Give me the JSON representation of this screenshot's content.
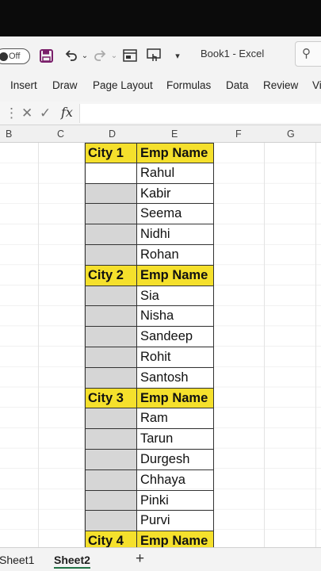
{
  "titlebar": {
    "autosave_label": "Off",
    "title": "Book1  -  Excel",
    "search_icon": "search-icon"
  },
  "ribbon": {
    "tabs": [
      "Insert",
      "Draw",
      "Page Layout",
      "Formulas",
      "Data",
      "Review",
      "Vi"
    ]
  },
  "formula_bar": {
    "fx_label": "fx",
    "value": ""
  },
  "columns": [
    "B",
    "C",
    "D",
    "E",
    "F",
    "G"
  ],
  "table": {
    "groups": [
      {
        "city_header": "City 1",
        "name_header": "Emp Name",
        "names": [
          "Rahul",
          "Kabir",
          "Seema",
          "Nidhi",
          "Rohan"
        ]
      },
      {
        "city_header": "City 2",
        "name_header": "Emp Name",
        "names": [
          "Sia",
          "Nisha",
          "Sandeep",
          "Rohit",
          "Santosh"
        ]
      },
      {
        "city_header": "City 3",
        "name_header": "Emp Name",
        "names": [
          "Ram",
          "Tarun",
          "Durgesh",
          "Chhaya",
          "Pinki",
          "Purvi"
        ]
      },
      {
        "city_header": "City 4",
        "name_header": "Emp Name",
        "names": []
      }
    ]
  },
  "sheets": {
    "tabs": [
      "Sheet1",
      "Sheet2"
    ],
    "active": "Sheet2",
    "add_label": "+"
  },
  "colors": {
    "header_fill": "#f5e02c",
    "selected_fill": "#d6d6d6",
    "excel_green": "#217346"
  }
}
